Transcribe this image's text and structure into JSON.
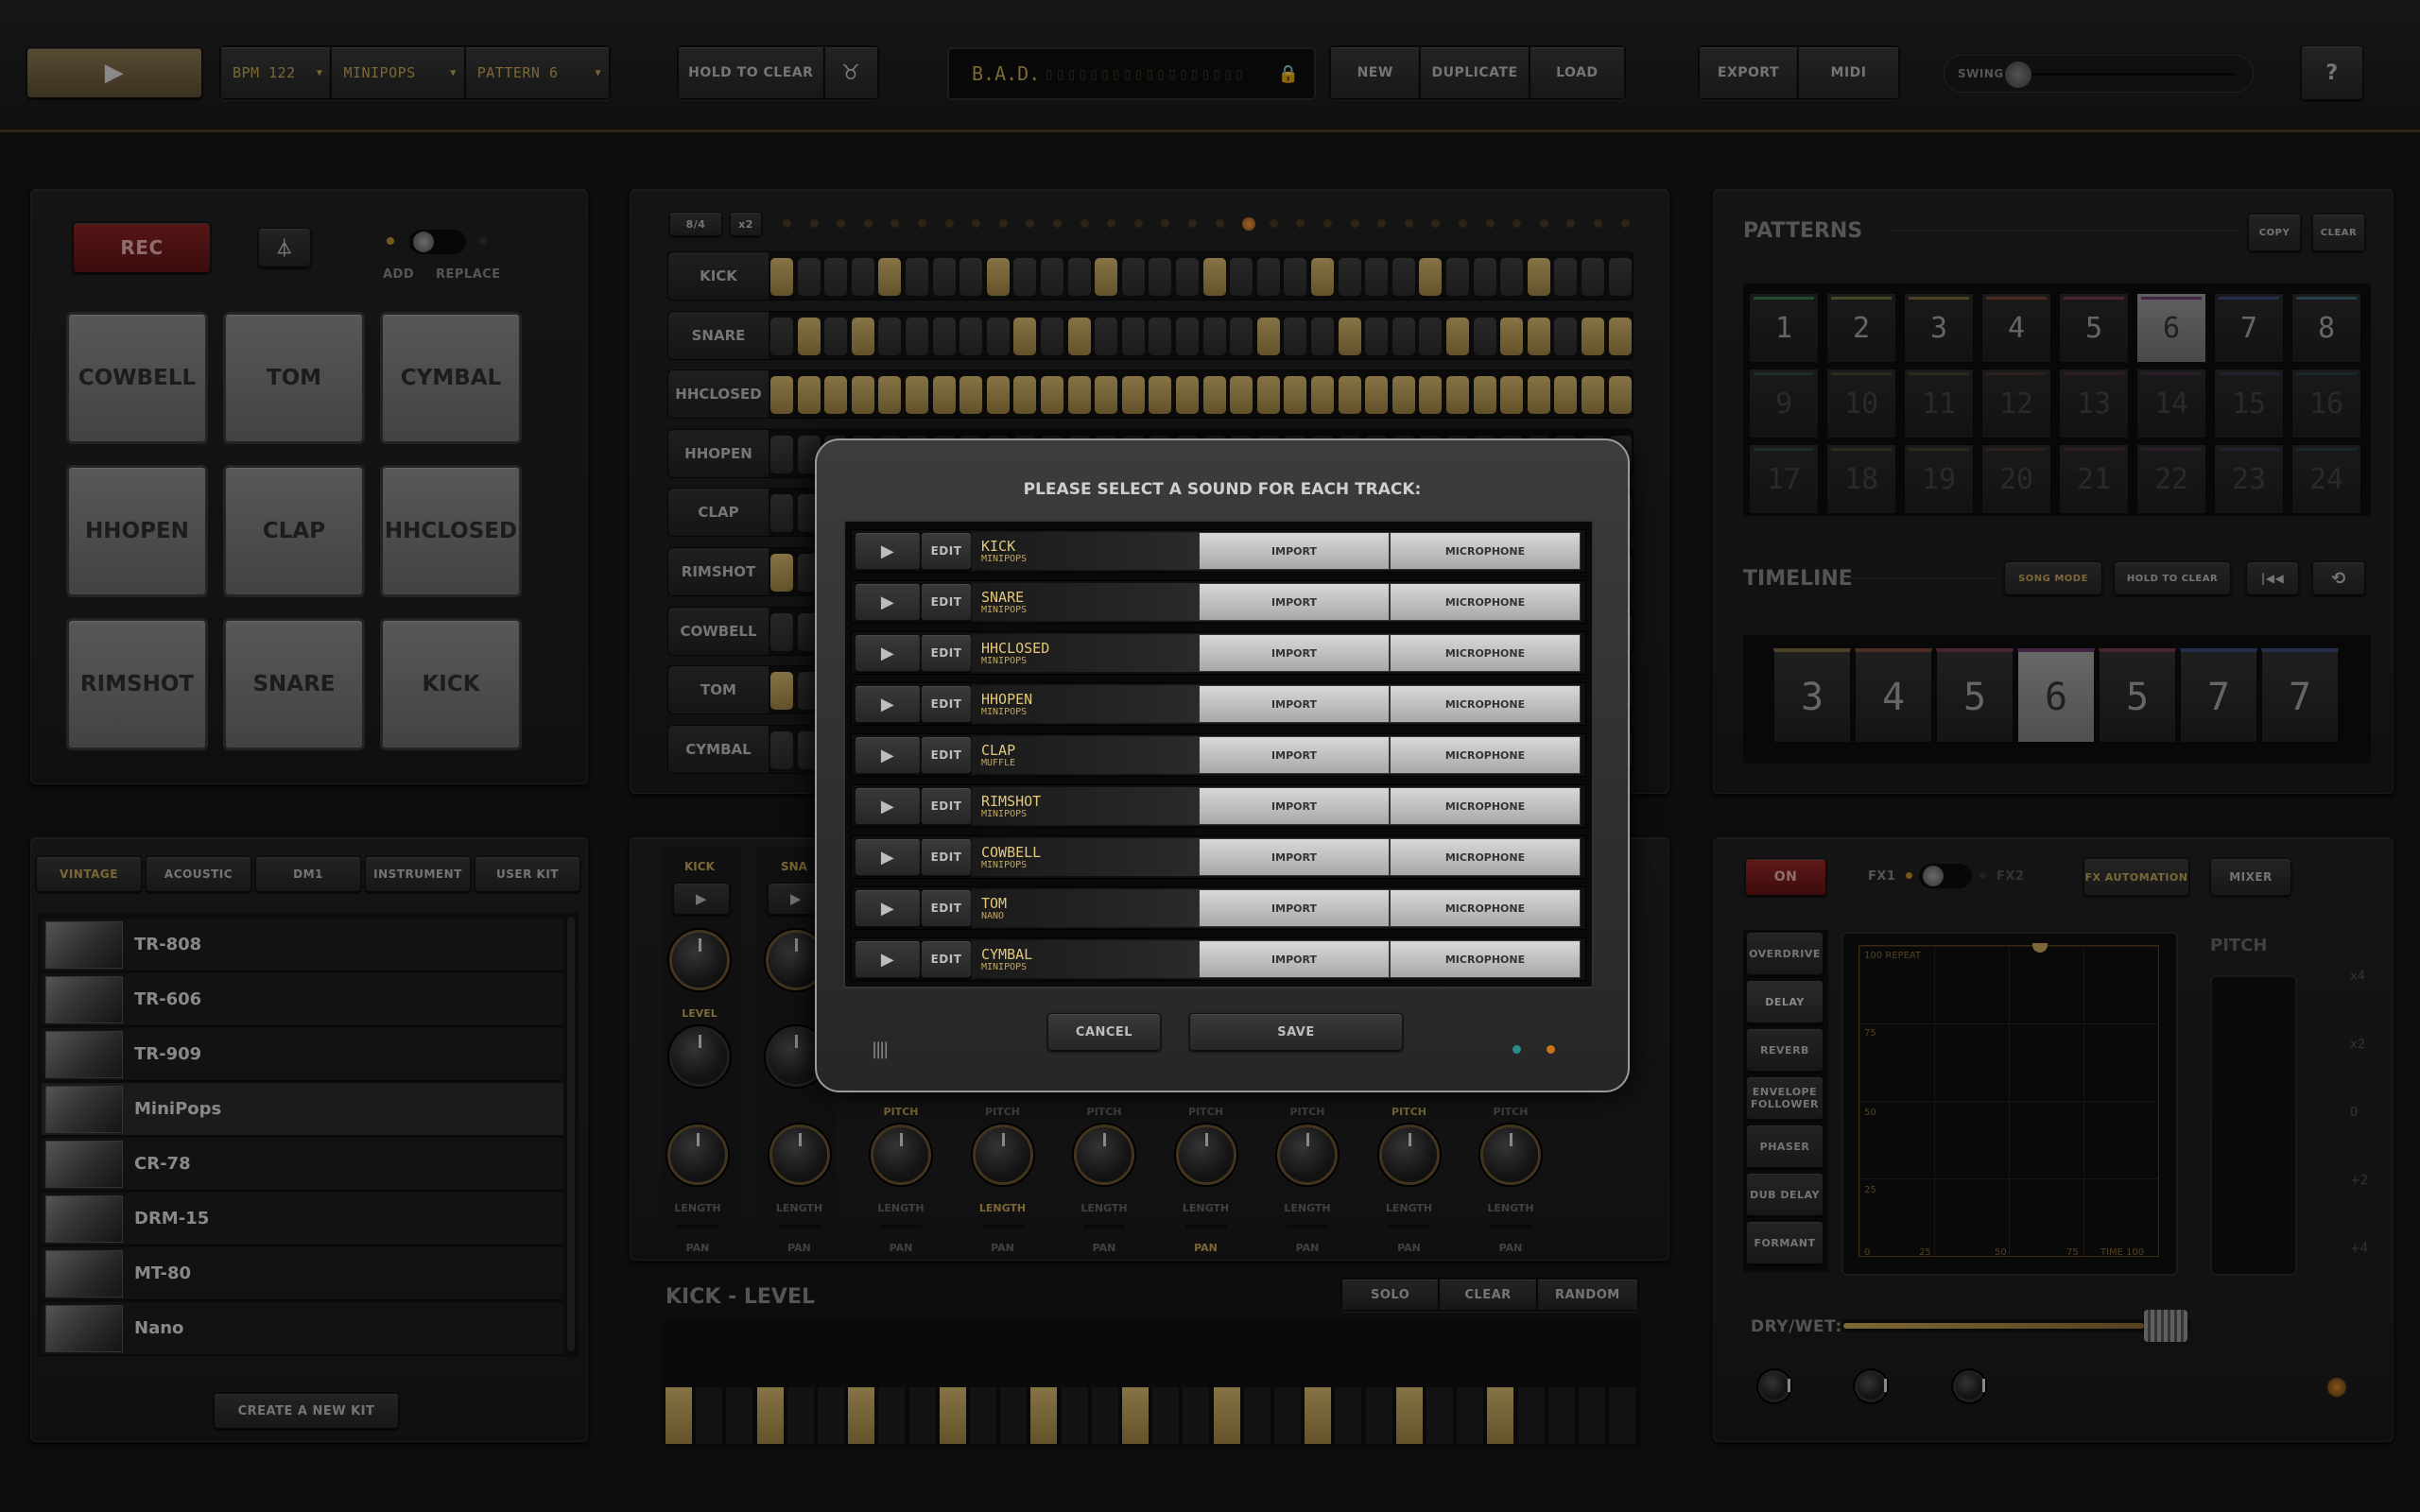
{
  "topbar": {
    "bpm": "BPM 122",
    "kit": "MINIPOPS",
    "pattern": "PATTERN 6",
    "hold_to_clear": "HOLD TO CLEAR",
    "song_name": "B.A.D.",
    "new": "NEW",
    "duplicate": "DUPLICATE",
    "load": "LOAD",
    "export": "EXPORT",
    "midi": "MIDI",
    "swing": "SWING",
    "help": "?"
  },
  "pads": {
    "rec": "REC",
    "add": "ADD",
    "replace": "REPLACE",
    "items": [
      "COWBELL",
      "TOM",
      "CYMBAL",
      "HHOPEN",
      "CLAP",
      "HHCLOSED",
      "RIMSHOT",
      "SNARE",
      "KICK"
    ]
  },
  "sequencer": {
    "meter": "8/4",
    "mult": "x2",
    "tracks": [
      {
        "name": "KICK",
        "steps": [
          1,
          0,
          0,
          0,
          1,
          0,
          0,
          0,
          1,
          0,
          0,
          0,
          1,
          0,
          0,
          0,
          1,
          0,
          0,
          0,
          1,
          0,
          0,
          0,
          1,
          0,
          0,
          0,
          1,
          0,
          0,
          0
        ]
      },
      {
        "name": "SNARE",
        "steps": [
          0,
          1,
          0,
          1,
          0,
          0,
          0,
          0,
          0,
          1,
          0,
          1,
          0,
          0,
          0,
          0,
          0,
          0,
          1,
          0,
          0,
          1,
          0,
          0,
          0,
          1,
          0,
          1,
          1,
          0,
          1,
          1
        ]
      },
      {
        "name": "HHCLOSED",
        "steps": [
          1,
          1,
          1,
          1,
          1,
          1,
          1,
          1,
          1,
          1,
          1,
          1,
          1,
          1,
          1,
          1,
          1,
          1,
          1,
          1,
          1,
          1,
          1,
          1,
          1,
          1,
          1,
          1,
          1,
          1,
          1,
          1
        ]
      },
      {
        "name": "HHOPEN",
        "steps": [
          0
        ]
      },
      {
        "name": "CLAP",
        "steps": [
          0
        ]
      },
      {
        "name": "RIMSHOT",
        "steps": [
          1
        ]
      },
      {
        "name": "COWBELL",
        "steps": [
          0
        ]
      },
      {
        "name": "TOM",
        "steps": [
          1
        ]
      },
      {
        "name": "CYMBAL",
        "steps": [
          0
        ]
      }
    ]
  },
  "patterns": {
    "title": "PATTERNS",
    "copy": "COPY",
    "clear": "CLEAR",
    "cells": [
      "1",
      "2",
      "3",
      "4",
      "5",
      "6",
      "7",
      "8",
      "9",
      "10",
      "11",
      "12",
      "13",
      "14",
      "15",
      "16",
      "17",
      "18",
      "19",
      "20",
      "21",
      "22",
      "23",
      "24"
    ],
    "selected": "6",
    "colors": [
      "#3f7a4a",
      "#6c7a3a",
      "#7a6a3a",
      "#7a4a3a",
      "#7a3a4a",
      "#6a3a6a",
      "#3a4a7a",
      "#3a6a7a"
    ]
  },
  "timeline": {
    "title": "TIMELINE",
    "song_mode": "SONG MODE",
    "hold_to_clear": "HOLD TO CLEAR",
    "cells": [
      "3",
      "4",
      "5",
      "6",
      "5",
      "7",
      "7"
    ],
    "selected_index": 3
  },
  "kits": {
    "tabs": [
      "VINTAGE",
      "ACOUSTIC",
      "DM1",
      "INSTRUMENT",
      "USER KIT"
    ],
    "items": [
      "TR-808",
      "TR-606",
      "TR-909",
      "MiniPops",
      "CR-78",
      "DRM-15",
      "MT-80",
      "Nano"
    ],
    "selected": "MiniPops",
    "create": "CREATE A NEW KIT"
  },
  "mixer": {
    "ch1": "KICK",
    "ch2": "SNA",
    "level": "LEVEL",
    "pitch": "PITCH",
    "length": "LENGTH",
    "pan": "PAN"
  },
  "editor": {
    "title": "KICK - LEVEL",
    "solo": "SOLO",
    "clear": "CLEAR",
    "random": "RANDOM"
  },
  "fx": {
    "on": "ON",
    "fx1": "FX1",
    "fx2": "FX2",
    "automation": "FX AUTOMATION",
    "mixer": "MIXER",
    "effects": [
      "OVERDRIVE",
      "DELAY",
      "REVERB",
      "ENVELOPE FOLLOWER",
      "PHASER",
      "DUB DELAY",
      "FORMANT"
    ],
    "selected": "DELAY",
    "pad_top": "100 REPEAT",
    "pad_y": [
      "75",
      "50",
      "25"
    ],
    "pad_x": [
      "0",
      "25",
      "50",
      "75",
      "TIME 100"
    ],
    "pitch": "PITCH",
    "pitch_scale": [
      "x4",
      "x2",
      "0",
      "+2",
      "+4"
    ],
    "drywet": "DRY/WET:"
  },
  "modal": {
    "title": "PLEASE SELECT A SOUND FOR EACH TRACK:",
    "edit": "EDIT",
    "import": "IMPORT",
    "microphone": "MICROPHONE",
    "rows": [
      {
        "track": "KICK",
        "kit": "MINIPOPS"
      },
      {
        "track": "SNARE",
        "kit": "MINIPOPS"
      },
      {
        "track": "HHCLOSED",
        "kit": "MINIPOPS"
      },
      {
        "track": "HHOPEN",
        "kit": "MINIPOPS"
      },
      {
        "track": "CLAP",
        "kit": "MUFFLE"
      },
      {
        "track": "RIMSHOT",
        "kit": "MINIPOPS"
      },
      {
        "track": "COWBELL",
        "kit": "MINIPOPS"
      },
      {
        "track": "TOM",
        "kit": "NANO"
      },
      {
        "track": "CYMBAL",
        "kit": "MINIPOPS"
      }
    ],
    "cancel": "CANCEL",
    "save": "SAVE"
  },
  "colors": {
    "accent": "#c9a757",
    "rec": "#8b1e1e"
  }
}
